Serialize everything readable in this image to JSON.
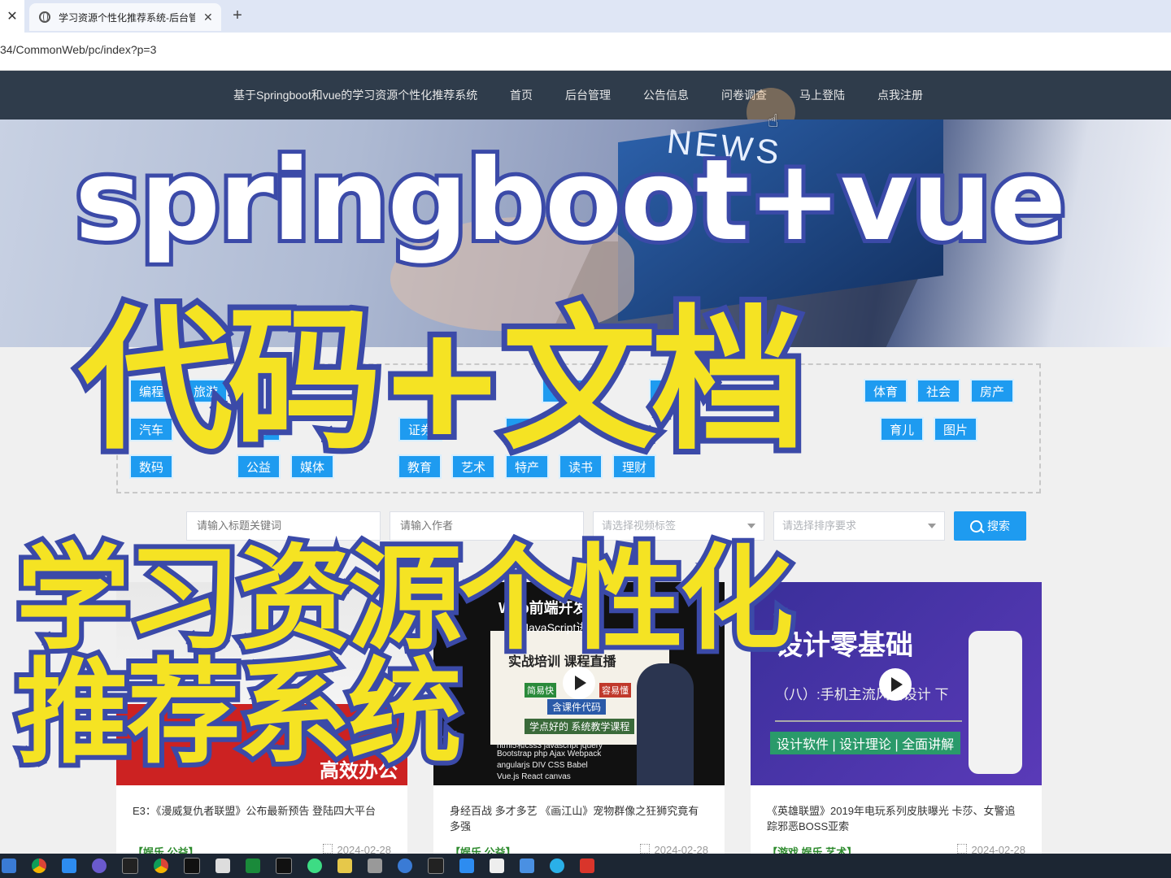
{
  "browser": {
    "tab_title": "学习资源个性化推荐系统-后台管",
    "url": "34/CommonWeb/pc/index?p=3"
  },
  "nav": {
    "brand": "基于Springboot和vue的学习资源个性化推荐系统",
    "items": [
      "首页",
      "后台管理",
      "公告信息",
      "问卷调查",
      "马上登陆",
      "点我注册"
    ]
  },
  "banner": {
    "news_text": "NEWS"
  },
  "overlay": {
    "en": "springboot+vue",
    "cn1": "代码+文档",
    "cn2": "学习资源个性化",
    "cn3": "推荐系统"
  },
  "tags": [
    "编程",
    "旅游",
    "考研",
    "国内",
    "体育",
    "社会",
    "房产",
    "汽车",
    "健康",
    "证券",
    "保险",
    "育儿",
    "图片",
    "数码",
    "公益",
    "媒体",
    "教育",
    "艺术",
    "特产",
    "读书",
    "理财"
  ],
  "search": {
    "title_placeholder": "请输入标题关键词",
    "author_placeholder": "请输入作者",
    "tag_placeholder": "请选择视频标签",
    "sort_placeholder": "请选择排序要求",
    "button": "搜索"
  },
  "cards": [
    {
      "title": "E3：《漫威复仇者联盟》公布最新预告 登陆四大平台",
      "tag": "【娱乐,公益】",
      "date": "2024-02-28",
      "thumb_text": "高效办公"
    },
    {
      "title": "身经百战 多才多艺 《画江山》宠物群像之狂狮究竟有多强",
      "tag": "【娱乐,公益】",
      "date": "2024-02-28",
      "thumb_text": "含课件代码"
    },
    {
      "title": "《英雄联盟》2019年电玩系列皮肤曝光 卡莎、女警追踪邪恶BOSS亚索",
      "tag": "【游戏,娱乐,艺术】",
      "date": "2024-02-28",
      "thumb_text": "设计零基础"
    }
  ],
  "thumb2": {
    "lines": [
      "Web前端开发",
      "JavaScript进阶",
      "实战培训 课程直播",
      "简易快",
      "容易懂",
      "学点好的 系统教学课程",
      "html5和css3 javascript jquery",
      "Bootstrap php Ajax Webpack",
      "angularjs DIV CSS Babel",
      "Vue.js React canvas"
    ]
  },
  "thumb3": {
    "sub": "（八）:手机主流风格设计 下",
    "bar": "设计软件 | 设计理论 | 全面讲解"
  },
  "colors": {
    "accent": "#1e9bf0",
    "nav_bg": "#2f3c4b",
    "overlay_yellow": "#f5e323",
    "overlay_stroke": "#3b4aa8",
    "tag_green": "#2e8b2e"
  }
}
